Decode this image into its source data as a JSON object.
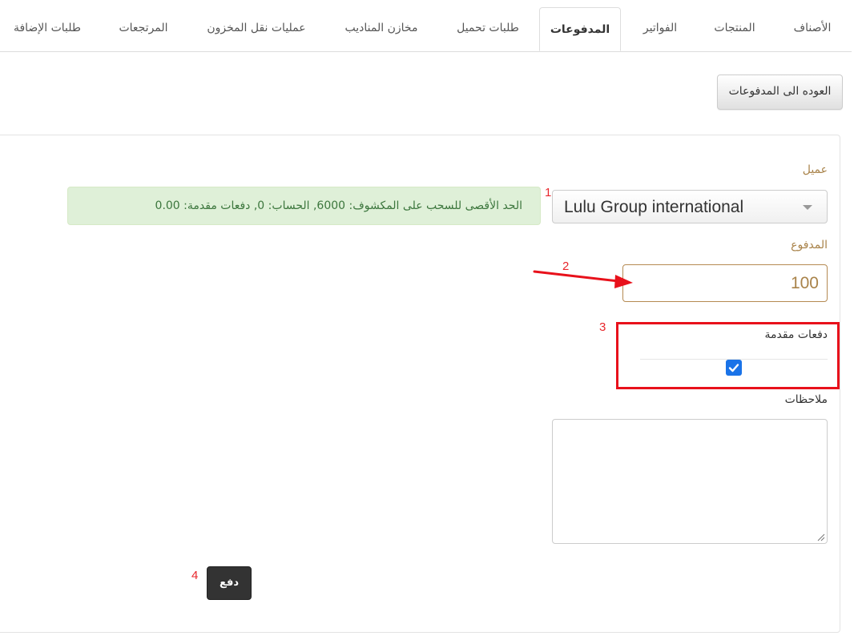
{
  "tabs": [
    {
      "label": "الأصناف",
      "active": false
    },
    {
      "label": "المنتجات",
      "active": false
    },
    {
      "label": "الفواتير",
      "active": false
    },
    {
      "label": "المدفوعات",
      "active": true
    },
    {
      "label": "طلبات تحميل",
      "active": false
    },
    {
      "label": "مخازن المناديب",
      "active": false
    },
    {
      "label": "عمليات نقل المخزون",
      "active": false
    },
    {
      "label": "المرتجعات",
      "active": false
    },
    {
      "label": "طلبات الإضافة",
      "active": false
    }
  ],
  "back_button_label": "العوده الى المدفوعات",
  "form": {
    "client_label": "عميل",
    "client_value": "Lulu Group international",
    "info_alert": "الحد الأقصى للسحب على المكشوف: 6000, الحساب: 0, دفعات مقدمة: 0.00",
    "payment_label": "المدفوع",
    "payment_value": "100",
    "advance_label": "دفعات مقدمة",
    "advance_checked": true,
    "notes_label": "ملاحظات",
    "notes_value": "",
    "submit_label": "دفع"
  },
  "annotations": {
    "marker_1": "1",
    "marker_2": "2",
    "marker_3": "3",
    "marker_4": "4",
    "color": "#e8111b"
  },
  "colors": {
    "label_gold": "#a9834a",
    "alert_bg": "#dff0d8",
    "alert_text": "#3c763d",
    "checkbox": "#1a73e8",
    "submit_bg": "#333333"
  }
}
